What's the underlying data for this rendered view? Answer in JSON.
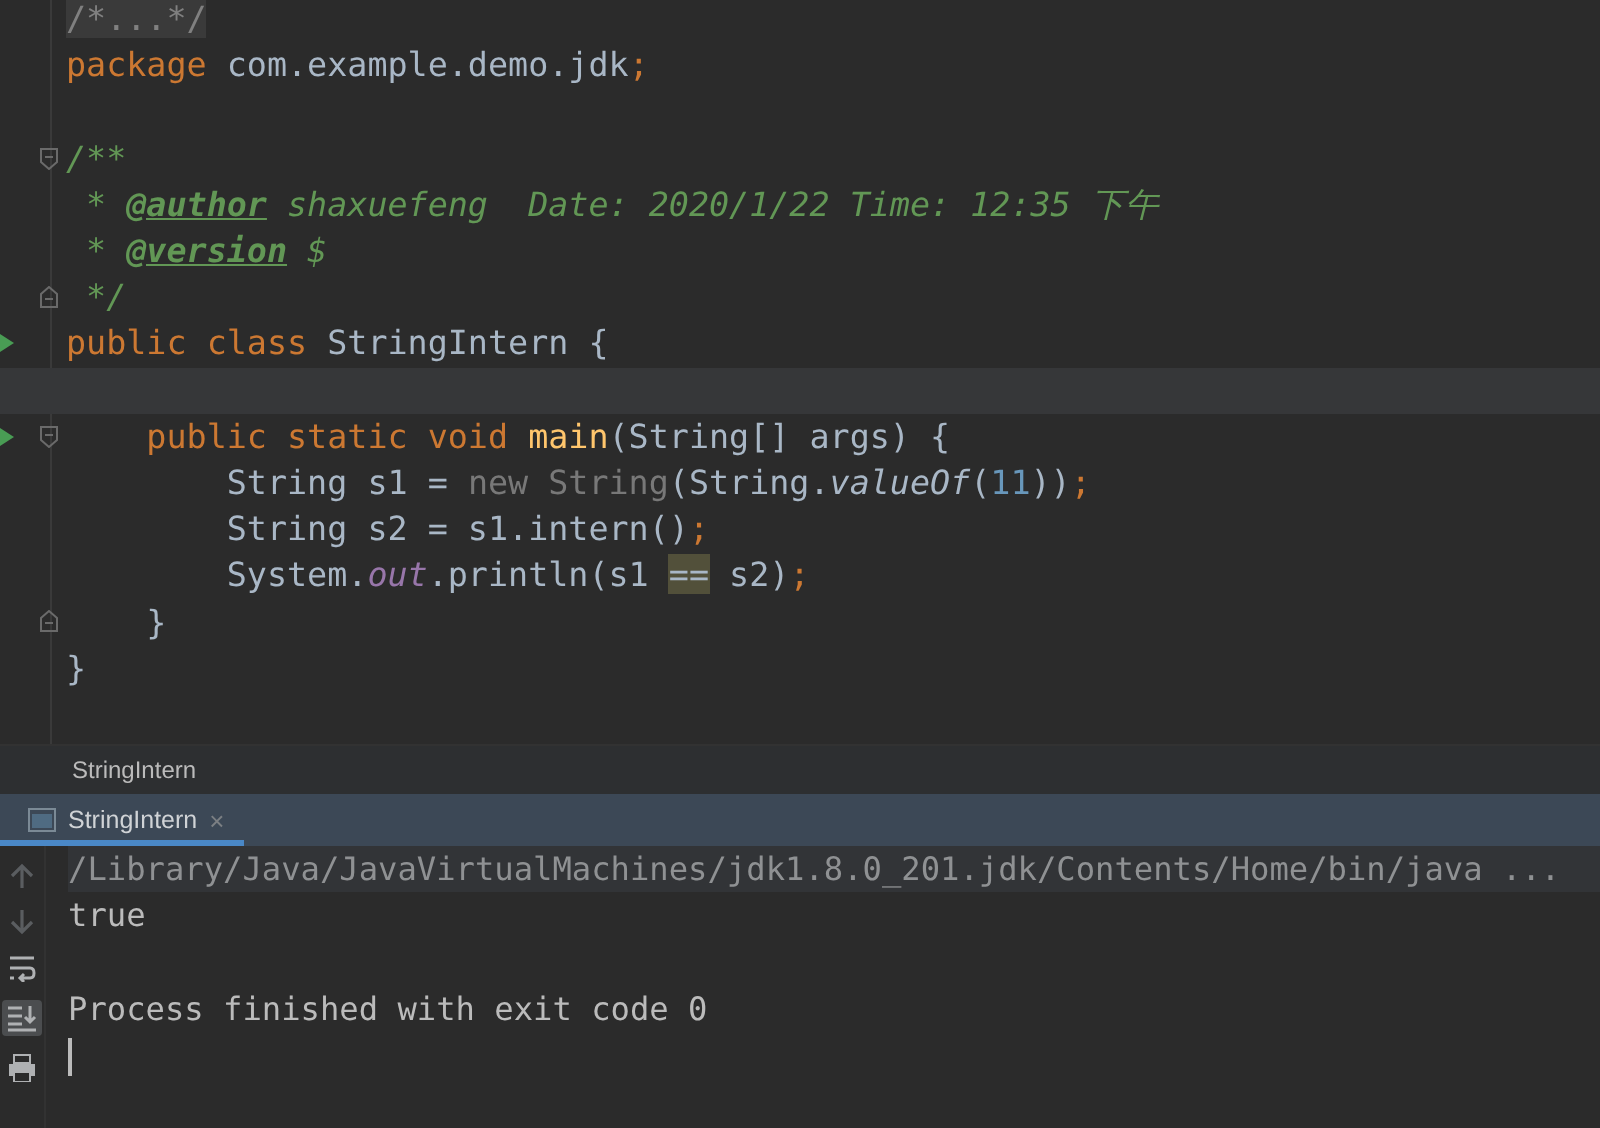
{
  "editor": {
    "lines": [
      {
        "kind": "code",
        "tokens": [
          {
            "text": "/*...*/",
            "kind": "folded"
          }
        ]
      },
      {
        "kind": "code",
        "tokens": [
          {
            "text": "package",
            "kind": "keyword"
          },
          {
            "text": " com.example.demo.jdk",
            "kind": "plain"
          },
          {
            "text": ";",
            "kind": "punct"
          }
        ]
      },
      {
        "kind": "blank"
      },
      {
        "kind": "code",
        "fold_start": true,
        "tokens": [
          {
            "text": "/**",
            "kind": "doc"
          }
        ]
      },
      {
        "kind": "code",
        "tokens": [
          {
            "text": " * ",
            "kind": "doc"
          },
          {
            "text": "@author",
            "kind": "doctag"
          },
          {
            "text": " shaxuefeng  Date: 2020/1/22 Time: 12:35 下午",
            "kind": "doc"
          }
        ]
      },
      {
        "kind": "code",
        "tokens": [
          {
            "text": " * ",
            "kind": "doc"
          },
          {
            "text": "@version",
            "kind": "doctag"
          },
          {
            "text": " $",
            "kind": "doc"
          }
        ]
      },
      {
        "kind": "code",
        "fold_end": true,
        "tokens": [
          {
            "text": " */",
            "kind": "doc"
          }
        ]
      },
      {
        "kind": "code",
        "run": true,
        "tokens": [
          {
            "text": "public class",
            "kind": "keyword"
          },
          {
            "text": " StringIntern {",
            "kind": "plain"
          }
        ]
      },
      {
        "kind": "blank",
        "current": true
      },
      {
        "kind": "code",
        "run": true,
        "fold_start": true,
        "tokens": [
          {
            "text": "    public static void",
            "kind": "keyword"
          },
          {
            "text": " main",
            "kind": "method"
          },
          {
            "text": "(String[] args) {",
            "kind": "plain"
          }
        ]
      },
      {
        "kind": "code",
        "tokens": [
          {
            "text": "        String s1 = ",
            "kind": "plain"
          },
          {
            "text": "new String",
            "kind": "unused"
          },
          {
            "text": "(String.",
            "kind": "plain"
          },
          {
            "text": "valueOf",
            "kind": "static"
          },
          {
            "text": "(",
            "kind": "plain"
          },
          {
            "text": "11",
            "kind": "number"
          },
          {
            "text": "))",
            "kind": "plain"
          },
          {
            "text": ";",
            "kind": "punct"
          }
        ]
      },
      {
        "kind": "code",
        "tokens": [
          {
            "text": "        String s2 = s1.intern()",
            "kind": "plain"
          },
          {
            "text": ";",
            "kind": "punct"
          }
        ]
      },
      {
        "kind": "code",
        "tokens": [
          {
            "text": "        System.",
            "kind": "plain"
          },
          {
            "text": "out",
            "kind": "field"
          },
          {
            "text": ".println(s1 ",
            "kind": "plain"
          },
          {
            "text": "==",
            "kind": "highlight"
          },
          {
            "text": " s2)",
            "kind": "plain"
          },
          {
            "text": ";",
            "kind": "punct"
          }
        ]
      },
      {
        "kind": "code",
        "fold_end": true,
        "tokens": [
          {
            "text": "    }",
            "kind": "plain"
          }
        ]
      },
      {
        "kind": "code",
        "tokens": [
          {
            "text": "}",
            "kind": "plain"
          }
        ]
      }
    ]
  },
  "breadcrumb": "StringIntern",
  "run_tabs": [
    {
      "label": "StringIntern",
      "selected": true,
      "close": "×"
    }
  ],
  "console": {
    "lines": [
      {
        "kind": "command",
        "text": "/Library/Java/JavaVirtualMachines/jdk1.8.0_201.jdk/Contents/Home/bin/java ..."
      },
      {
        "kind": "output",
        "text": "true"
      },
      {
        "kind": "blank"
      },
      {
        "kind": "output",
        "text": "Process finished with exit code 0"
      },
      {
        "kind": "cursor"
      }
    ]
  }
}
